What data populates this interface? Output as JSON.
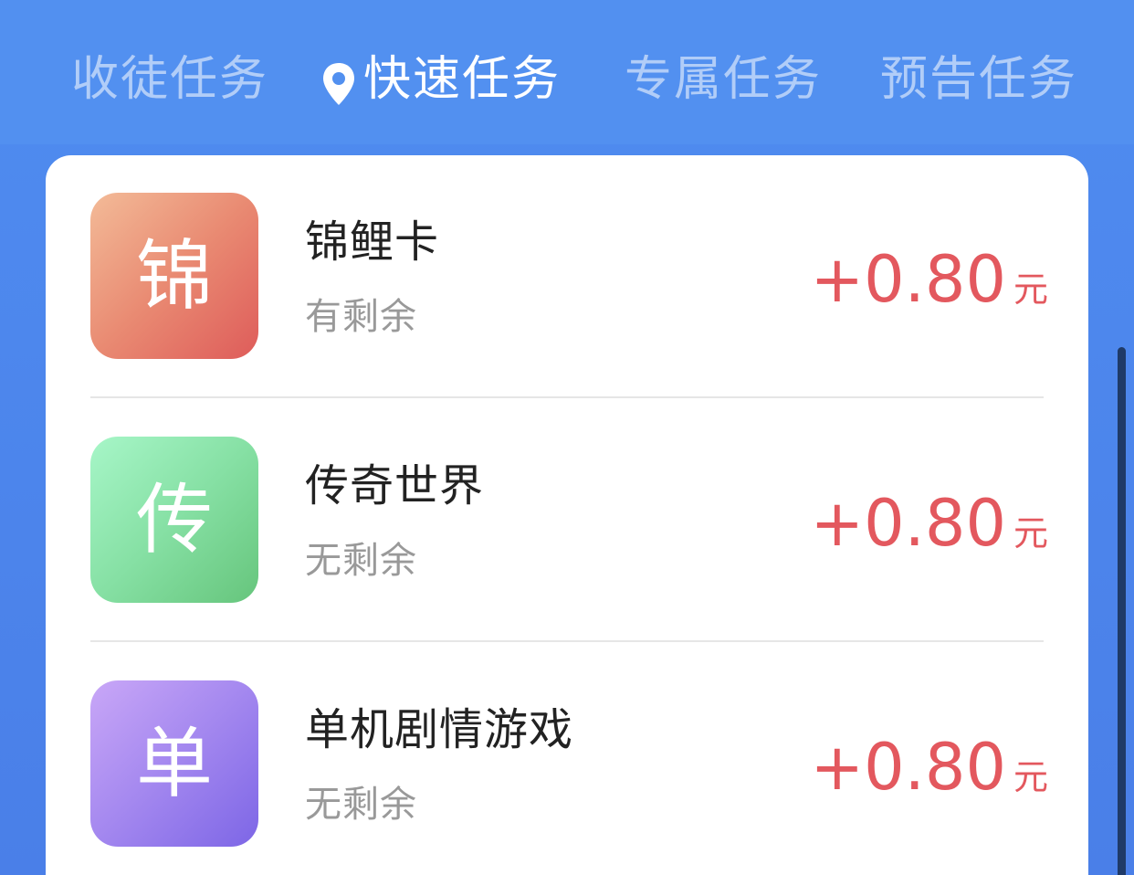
{
  "tabs": [
    {
      "label": "收徒任务",
      "active": false
    },
    {
      "label": "快速任务",
      "active": true,
      "icon": "location-pin-icon"
    },
    {
      "label": "专属任务",
      "active": false
    },
    {
      "label": "预告任务",
      "active": false
    }
  ],
  "tasks": [
    {
      "icon_char": "锦",
      "name": "锦鲤卡",
      "status": "有剩余",
      "amount": "+0.80",
      "unit": "元",
      "icon_color": "#e5766a"
    },
    {
      "icon_char": "传",
      "name": "传奇世界",
      "status": "无剩余",
      "amount": "+0.80",
      "unit": "元",
      "icon_color": "#7fd79b"
    },
    {
      "icon_char": "单",
      "name": "单机剧情游戏",
      "status": "无剩余",
      "amount": "+0.80",
      "unit": "元",
      "icon_color": "#a084ee"
    }
  ],
  "colors": {
    "header_bg": "#5290f0",
    "reward": "#e3585e",
    "task_name": "#222222",
    "task_status": "#999999"
  }
}
